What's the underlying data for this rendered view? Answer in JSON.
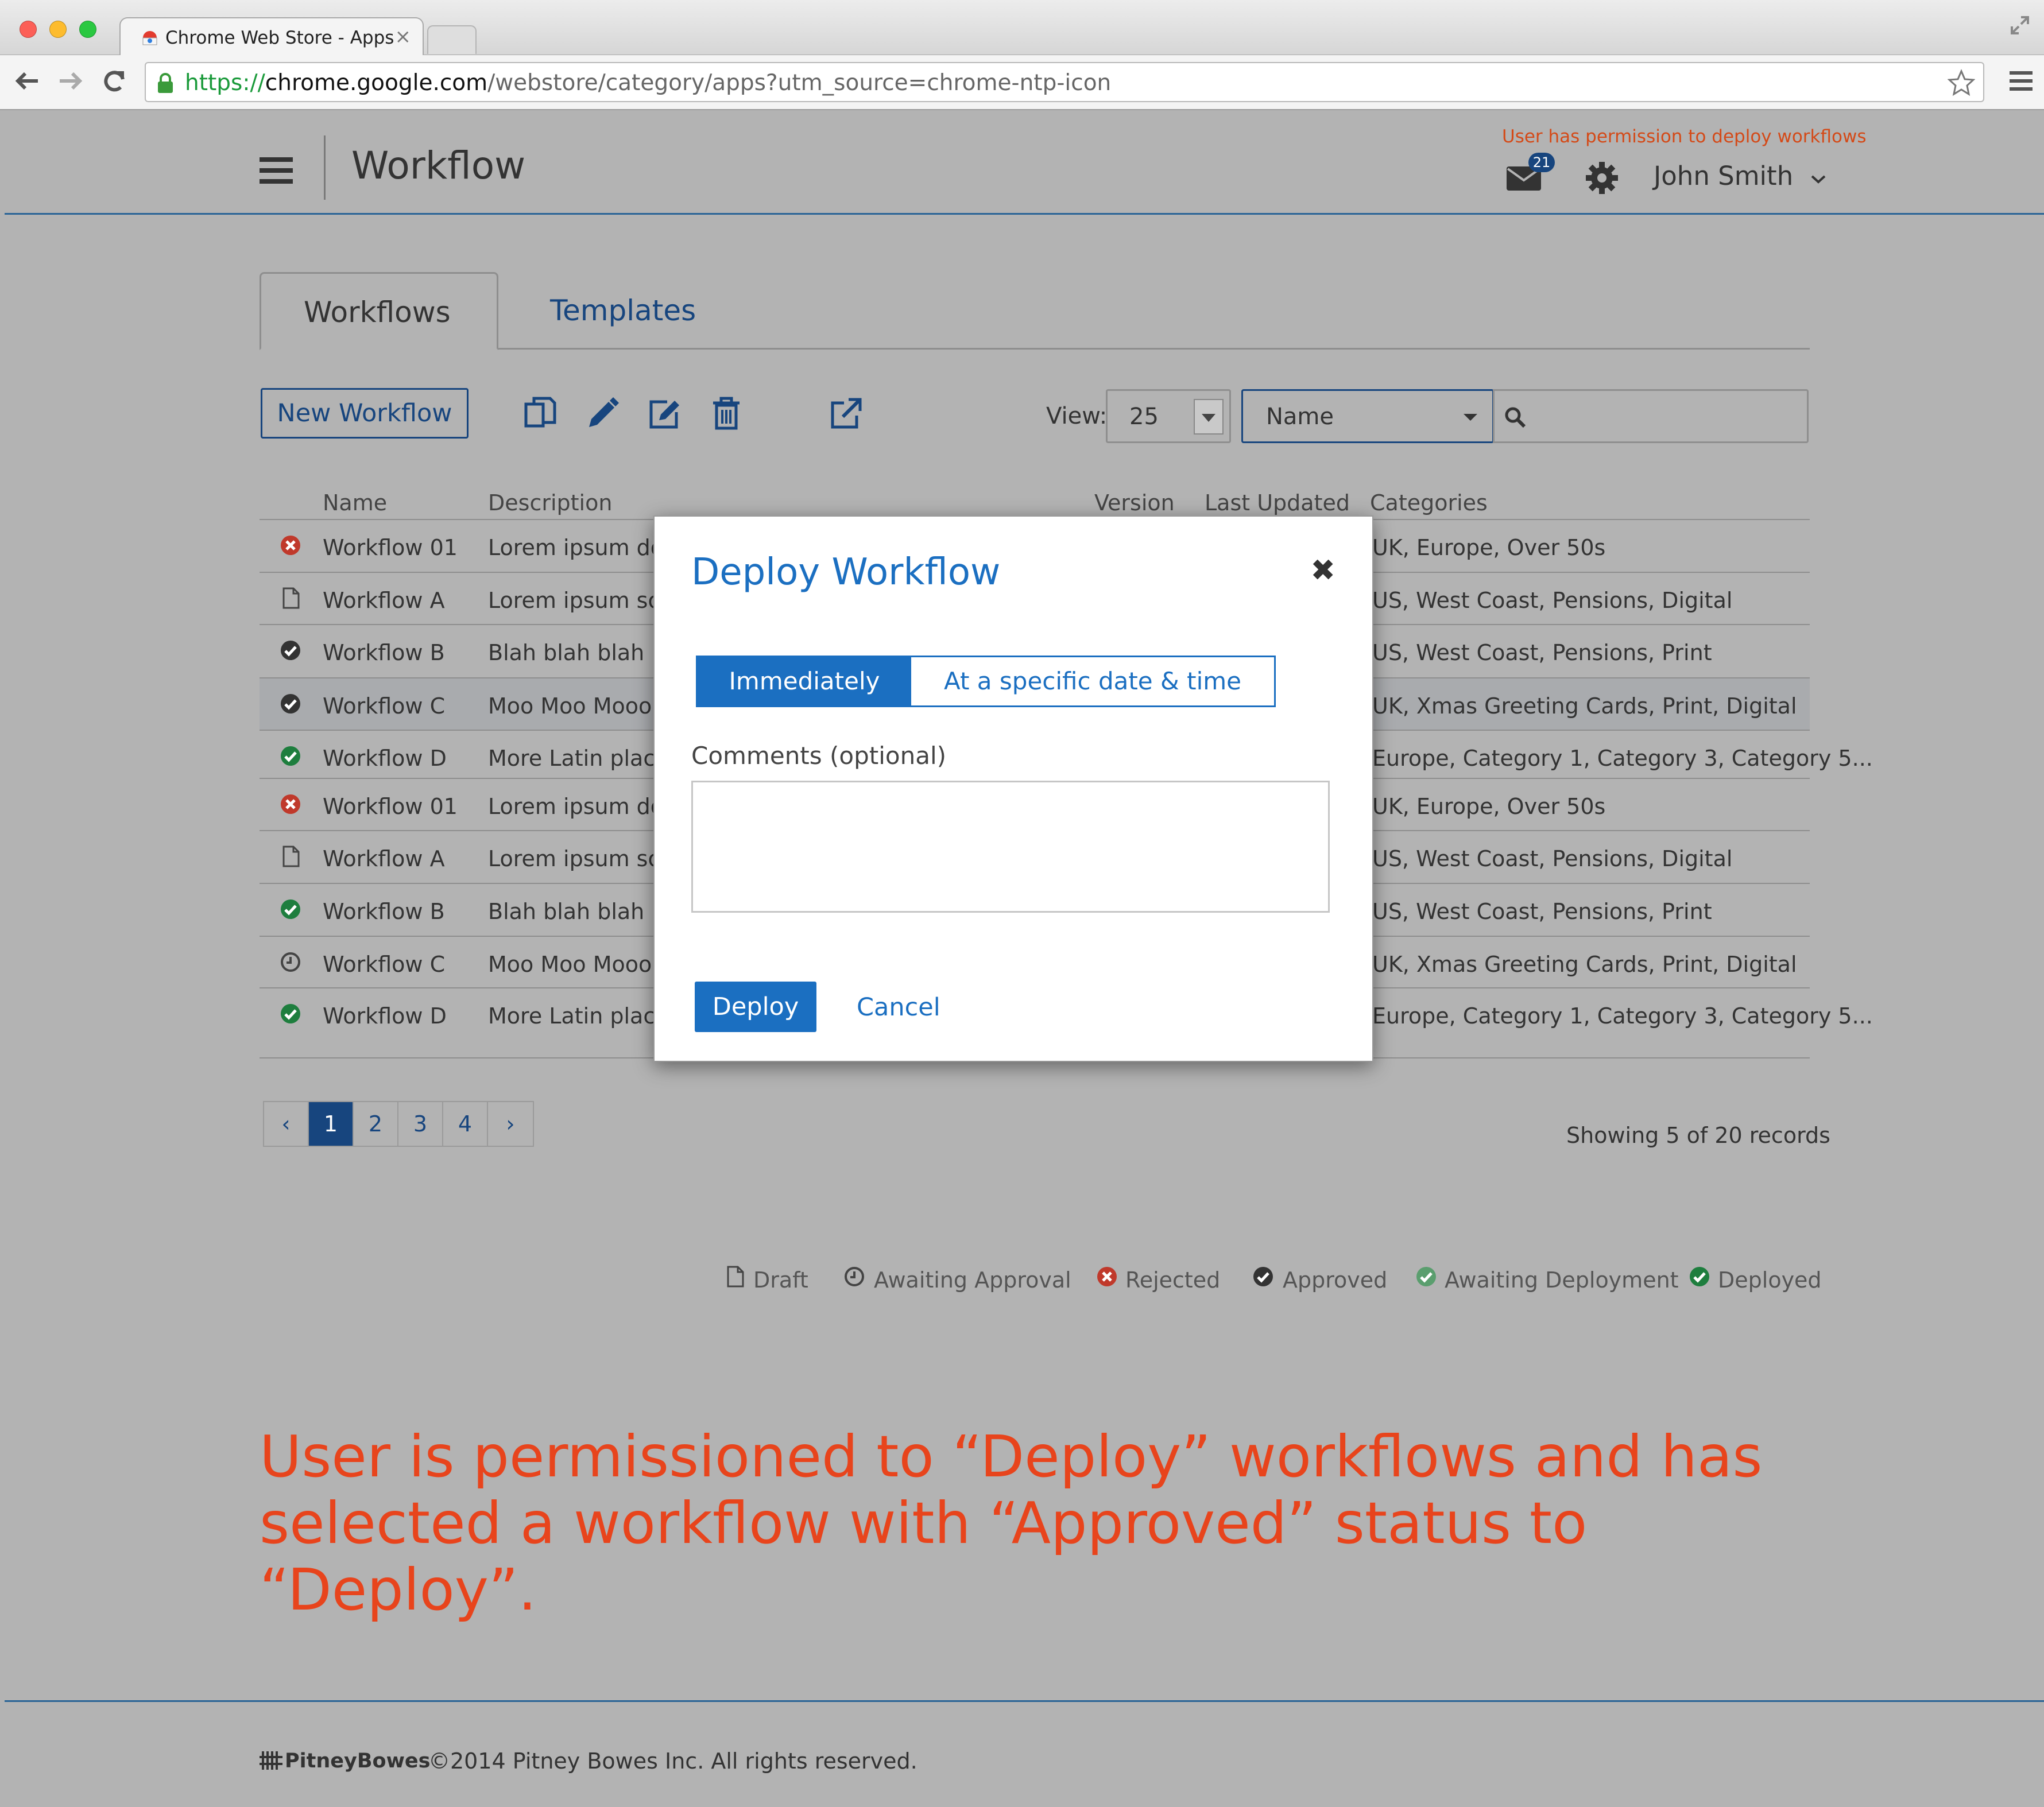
{
  "browser": {
    "tab_title": "Chrome Web Store - Apps",
    "url_scheme": "https://",
    "url_host": "chrome.google.com",
    "url_path": "/webstore/category/apps?utm_source=chrome-ntp-icon"
  },
  "header": {
    "app_title": "Workflow",
    "permission_note": "User has permission to deploy workflows",
    "mail_badge_count": "21",
    "user_name": "John Smith"
  },
  "tabs": [
    {
      "label": "Workflows",
      "active": true
    },
    {
      "label": "Templates",
      "active": false
    }
  ],
  "toolbar": {
    "new_workflow_label": "New Workflow",
    "icons": [
      "copy-icon",
      "pencil-icon",
      "edit-square-icon",
      "trash-icon",
      "external-link-icon"
    ],
    "view_label": "View:",
    "view_value": "25",
    "sort_value": "Name",
    "search_value": ""
  },
  "table": {
    "headers": {
      "name": "Name",
      "description": "Description",
      "version": "Version",
      "last_updated": "Last Updated",
      "categories": "Categories"
    },
    "rows": [
      {
        "status": "rejected",
        "name": "Workflow 01",
        "description": "Lorem ipsum do",
        "categories": "UK, Europe, Over 50s"
      },
      {
        "status": "draft",
        "name": "Workflow A",
        "description": "Lorem ipsum so",
        "categories": "US, West Coast, Pensions, Digital"
      },
      {
        "status": "approved",
        "name": "Workflow B",
        "description": "Blah blah blah",
        "categories": "US, West Coast, Pensions, Print"
      },
      {
        "status": "approved",
        "name": "Workflow C",
        "description": "Moo Moo Mooo",
        "categories": "UK, Xmas Greeting Cards, Print, Digital",
        "selected": true
      },
      {
        "status": "deployed",
        "name": "Workflow D",
        "description": "More Latin place",
        "categories": "Europe, Category 1, Category 3, Category 5..."
      },
      {
        "status": "rejected",
        "name": "Workflow 01",
        "description": "Lorem ipsum do",
        "categories": "UK, Europe, Over 50s"
      },
      {
        "status": "draft",
        "name": "Workflow A",
        "description": "Lorem ipsum so",
        "categories": "US, West Coast, Pensions, Digital"
      },
      {
        "status": "deployed",
        "name": "Workflow B",
        "description": "Blah blah blah",
        "categories": "US, West Coast, Pensions, Print"
      },
      {
        "status": "awaiting-approval",
        "name": "Workflow C",
        "description": "Moo Moo Mooo",
        "categories": "UK, Xmas Greeting Cards, Print, Digital"
      },
      {
        "status": "deployed",
        "name": "Workflow D",
        "description": "More Latin place",
        "categories": "Europe, Category 1, Category 3, Category 5..."
      }
    ]
  },
  "pagination": {
    "prev": "‹",
    "pages": [
      "1",
      "2",
      "3",
      "4"
    ],
    "current_page": "1",
    "next": "›",
    "records_text": "Showing 5 of 20 records"
  },
  "legend": [
    {
      "status": "draft",
      "label": "Draft"
    },
    {
      "status": "awaiting-approval",
      "label": "Awaiting Approval"
    },
    {
      "status": "rejected",
      "label": "Rejected"
    },
    {
      "status": "approved",
      "label": "Approved"
    },
    {
      "status": "awaiting-deployment",
      "label": "Awaiting Deployment"
    },
    {
      "status": "deployed",
      "label": "Deployed"
    }
  ],
  "annotation": "User is permissioned to “Deploy” workflows and has selected a workflow with “Approved” status to “Deploy”.",
  "footer": {
    "logo_text": "PitneyBowes",
    "copyright": "©2014 Pitney Bowes Inc. All rights reserved."
  },
  "modal": {
    "title": "Deploy Workflow",
    "close": "✖",
    "option_immediately": "Immediately",
    "option_specific": "At a specific date & time",
    "comments_label": "Comments (optional)",
    "comments_value": "",
    "deploy_label": "Deploy",
    "cancel_label": "Cancel"
  },
  "colors": {
    "brand_blue": "#1b6fc1",
    "dark_blue": "#17457e",
    "annotation_orange": "#e8441c",
    "rejected_red": "#c0392b",
    "deployed_green": "#1e7e3e",
    "approved_gray": "#333333",
    "awaiting_deployment_green": "#5a9e6e"
  }
}
